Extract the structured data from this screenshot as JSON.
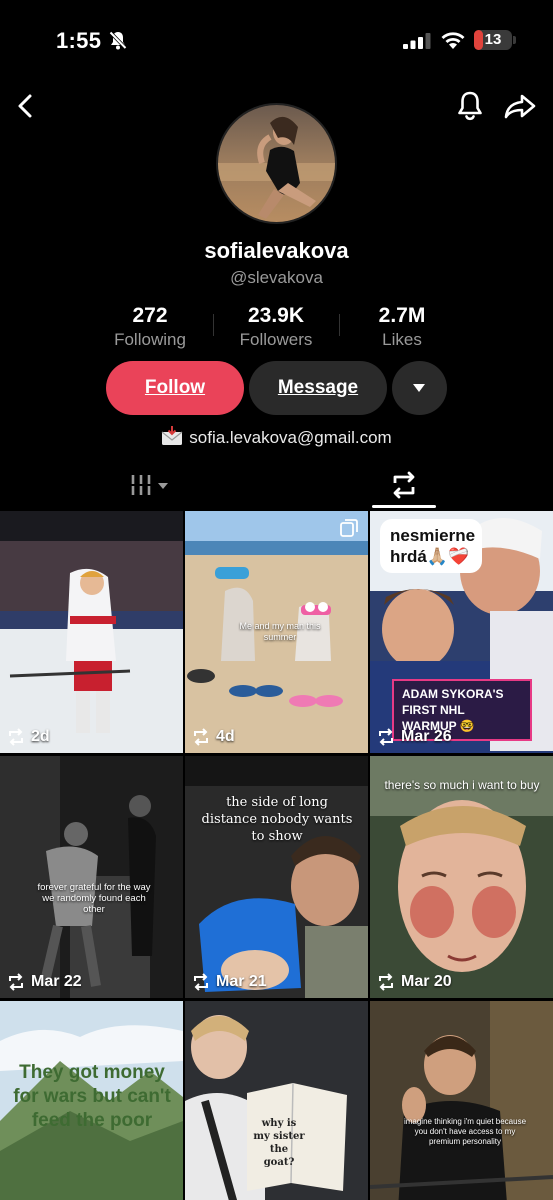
{
  "status_bar": {
    "time": "1:55",
    "battery": "13",
    "battery_fraction": 0.13
  },
  "profile": {
    "display_name": "sofialevakova",
    "handle": "@slevakova",
    "stats": [
      {
        "value": "272",
        "label": "Following"
      },
      {
        "value": "23.9K",
        "label": "Followers"
      },
      {
        "value": "2.7M",
        "label": "Likes"
      }
    ],
    "buttons": {
      "follow": "Follow",
      "message": "Message"
    },
    "email": "sofia.levakova@gmail.com"
  },
  "tabs": {
    "active": "reposts",
    "icons": [
      "grid-filter-icon",
      "repost-icon"
    ]
  },
  "videos": [
    {
      "meta": "2d",
      "overlay": ""
    },
    {
      "meta": "4d",
      "overlay": "Me and my man this summer"
    },
    {
      "meta": "Mar 26",
      "bubble": "nesmierne hrdá🙏🏼❤️‍🩹",
      "banner": "ADAM SYKORA'S FIRST NHL WARMUP 🤓"
    },
    {
      "meta": "Mar 22",
      "overlay": "forever grateful for the way we randomly found each other"
    },
    {
      "meta": "Mar 21",
      "overlay": "the side of long distance nobody wants to show"
    },
    {
      "meta": "Mar 20",
      "overlay": "there's so much i want to buy"
    },
    {
      "meta": "",
      "overlay": "They got money for wars but can't feed the poor"
    },
    {
      "meta": "",
      "overlay": "why is my sister the goat?"
    },
    {
      "meta": "",
      "overlay": "imagine thinking i'm quiet because you don't have access to my premium personality"
    }
  ],
  "colors": {
    "follow": "#ea4359",
    "button_dark": "#2a2a2a",
    "muted": "#9a9a9a"
  }
}
